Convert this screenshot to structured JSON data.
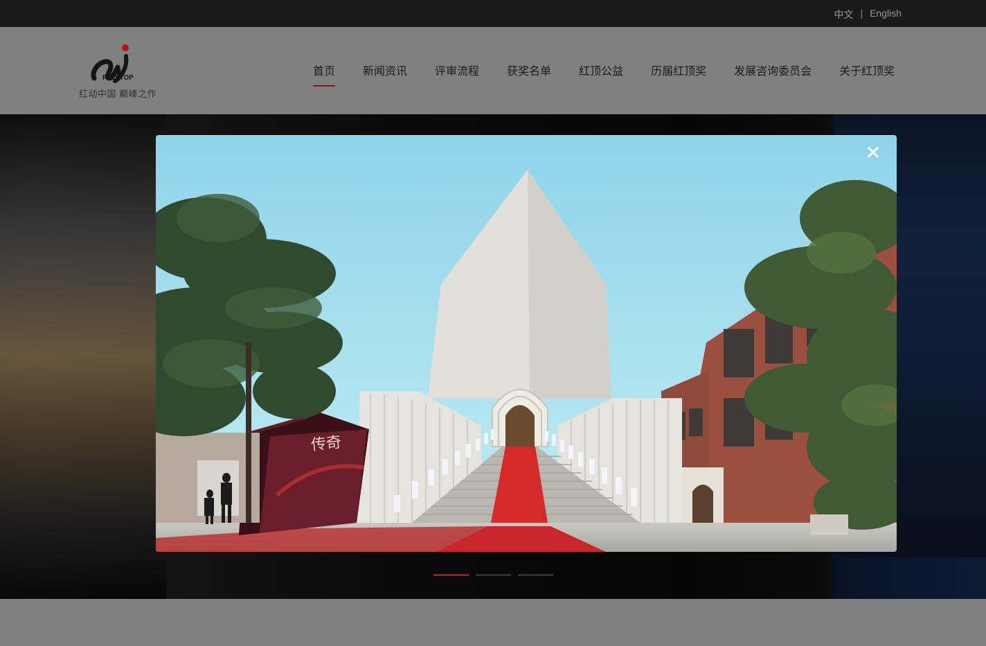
{
  "language_bar": {
    "chinese": "中文",
    "separator": "|",
    "english": "English"
  },
  "header": {
    "logo_text": "RED-TOP",
    "slogan": "红动中国 巅峰之作"
  },
  "nav": {
    "items": [
      {
        "label": "首页",
        "active": true
      },
      {
        "label": "新闻资讯"
      },
      {
        "label": "评审流程"
      },
      {
        "label": "获奖名单"
      },
      {
        "label": "红顶公益"
      },
      {
        "label": "历届红顶奖"
      },
      {
        "label": "发展咨询委员会"
      },
      {
        "label": "关于红顶奖"
      }
    ]
  },
  "modal": {
    "close_icon": "close-icon",
    "sign_text": "传奇"
  },
  "carousel": {
    "count": 3,
    "active_index": 0
  },
  "colors": {
    "accent": "#8b0d14",
    "carpet": "#d42a2a",
    "sky": "#a4e0ee"
  }
}
